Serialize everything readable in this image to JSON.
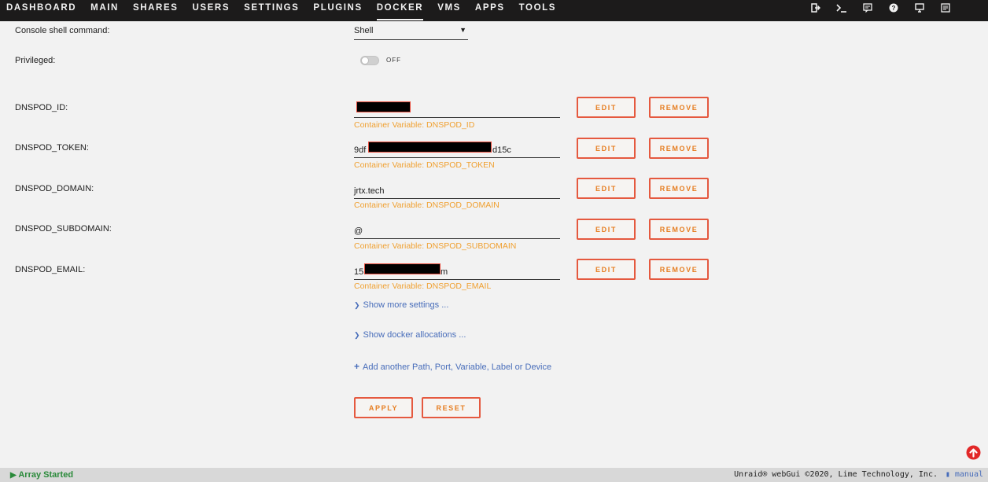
{
  "nav": {
    "items": [
      "DASHBOARD",
      "MAIN",
      "SHARES",
      "USERS",
      "SETTINGS",
      "PLUGINS",
      "DOCKER",
      "VMS",
      "APPS",
      "TOOLS"
    ],
    "active": "DOCKER",
    "icons": [
      "logout-icon",
      "terminal-icon",
      "feedback-icon",
      "help-icon",
      "info-icon",
      "log-icon"
    ]
  },
  "console": {
    "label": "Console shell command:",
    "value": "Shell"
  },
  "privileged": {
    "label": "Privileged:",
    "state": "OFF"
  },
  "variables": [
    {
      "label": "DNSPOD_ID:",
      "value_prefix": "",
      "value_suffix": "",
      "hint": "Container Variable: DNSPOD_ID",
      "redacted": true
    },
    {
      "label": "DNSPOD_TOKEN:",
      "value_prefix": "9df",
      "value_suffix": "d15c",
      "hint": "Container Variable: DNSPOD_TOKEN",
      "redacted": true
    },
    {
      "label": "DNSPOD_DOMAIN:",
      "value_prefix": "jrtx.tech",
      "value_suffix": "",
      "hint": "Container Variable: DNSPOD_DOMAIN",
      "redacted": false
    },
    {
      "label": "DNSPOD_SUBDOMAIN:",
      "value_prefix": "@",
      "value_suffix": "",
      "hint": "Container Variable: DNSPOD_SUBDOMAIN",
      "redacted": false
    },
    {
      "label": "DNSPOD_EMAIL:",
      "value_prefix": "15",
      "value_suffix": "m",
      "hint": "Container Variable: DNSPOD_EMAIL",
      "redacted": true
    }
  ],
  "buttons": {
    "edit": "EDIT",
    "remove": "REMOVE",
    "apply": "APPLY",
    "reset": "RESET"
  },
  "links": {
    "more_settings": "Show more settings ...",
    "docker_allocations": "Show docker allocations ...",
    "add_another": "Add another Path, Port, Variable, Label or Device"
  },
  "footer": {
    "status": "Array Started",
    "copyright": "Unraid® webGui ©2020, Lime Technology, Inc.",
    "manual": "manual"
  },
  "colors": {
    "accent": "#e67e22",
    "button_border": "#e5593f",
    "hint": "#f0a030",
    "link": "#486dba",
    "status": "#2a8a3a"
  }
}
